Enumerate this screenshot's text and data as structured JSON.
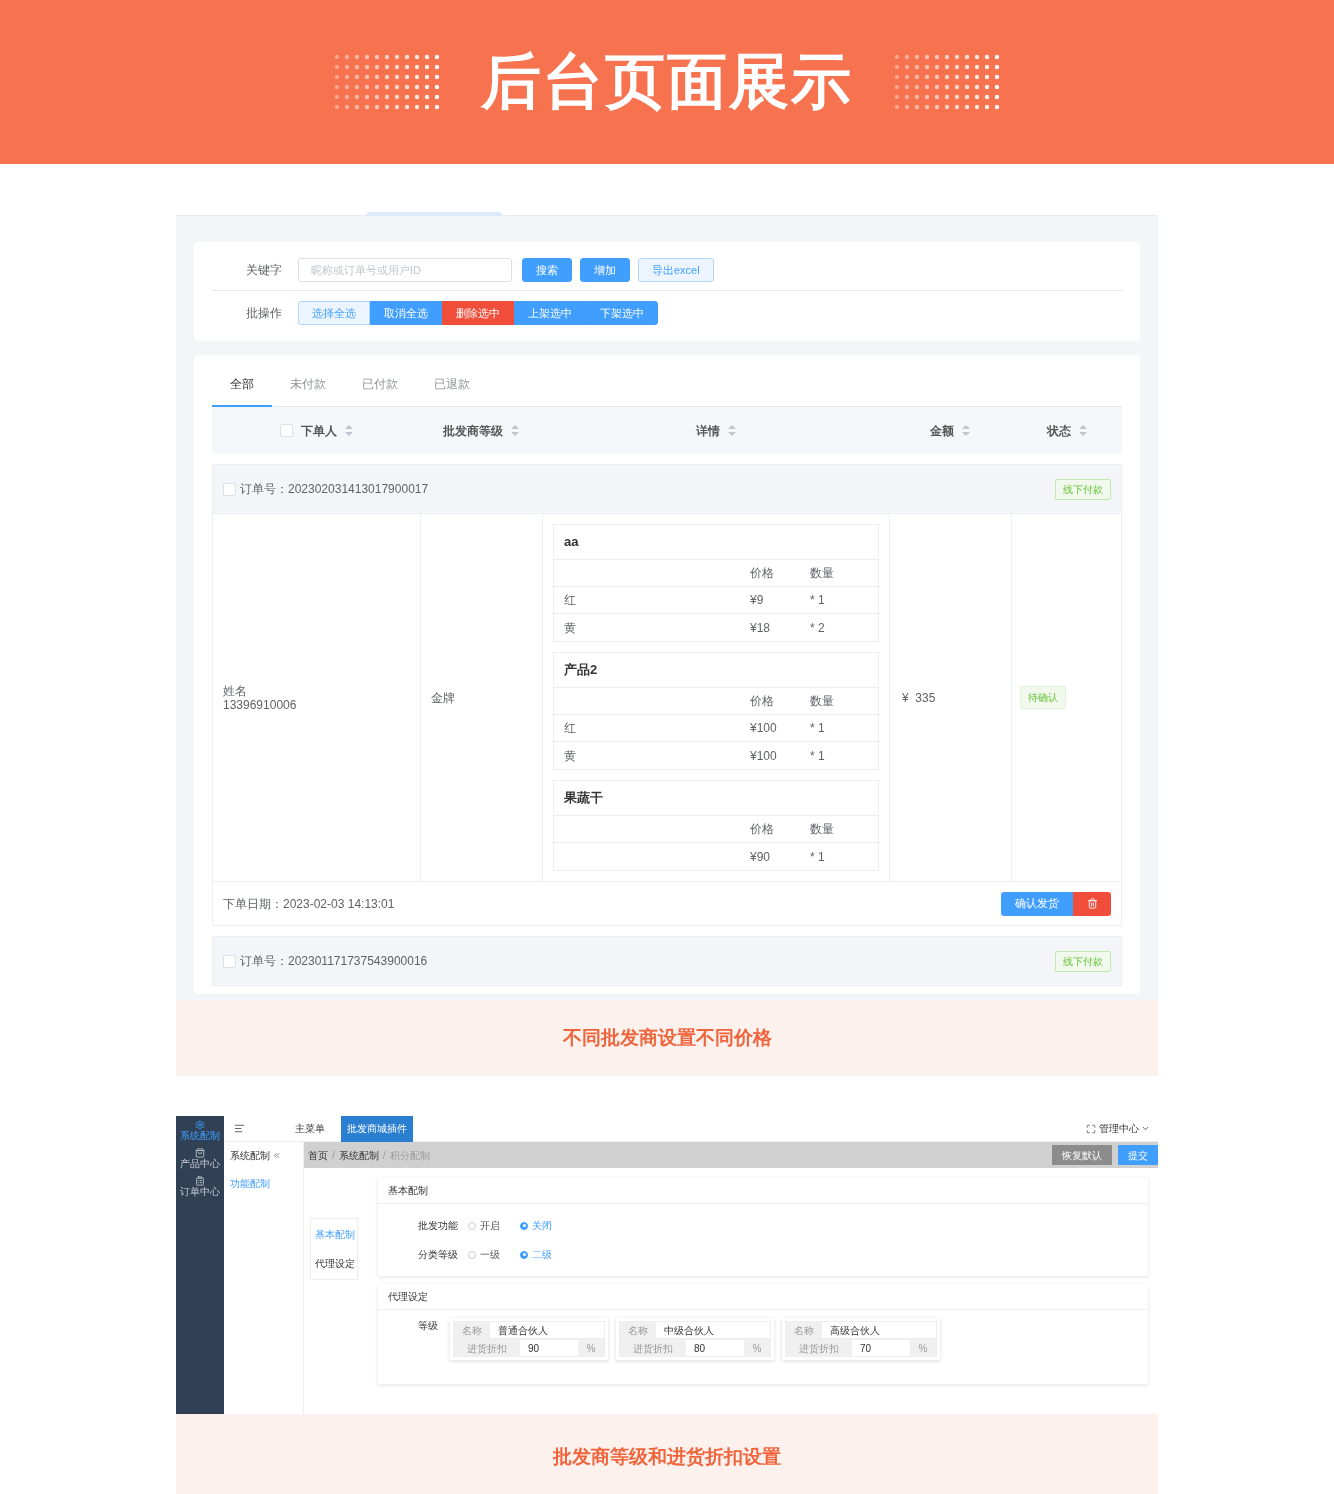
{
  "banner": {
    "title": "后台页面展示"
  },
  "order_admin": {
    "search": {
      "label": "关键字",
      "placeholder": "昵称或订单号或用户ID",
      "buttons": [
        {
          "label": "搜索",
          "kind": "primary"
        },
        {
          "label": "增加",
          "kind": "primary"
        },
        {
          "label": "导出excel",
          "kind": "plain"
        }
      ]
    },
    "batch": {
      "label": "批操作",
      "buttons": [
        {
          "label": "选择全选",
          "kind": "plain"
        },
        {
          "label": "取消全选",
          "kind": "primary"
        },
        {
          "label": "删除选中",
          "kind": "danger"
        },
        {
          "label": "上架选中",
          "kind": "primary"
        },
        {
          "label": "下架选中",
          "kind": "primary"
        }
      ]
    },
    "tabs": [
      {
        "label": "全部",
        "selected": true
      },
      {
        "label": "未付款",
        "selected": false
      },
      {
        "label": "已付款",
        "selected": false
      },
      {
        "label": "已退款",
        "selected": false
      }
    ],
    "table": {
      "select_all_checked": false,
      "columns": [
        "下单人",
        "批发商等级",
        "详情",
        "金额",
        "状态"
      ],
      "orders": [
        {
          "checked": false,
          "order_no": "订单号：202302031413017900017",
          "payment_tag": "线下付款",
          "buyer": [
            "姓名",
            "13396910006"
          ],
          "level": "金牌",
          "products": [
            {
              "name": "aa",
              "headers": [
                "价格",
                "数量"
              ],
              "rows": [
                {
                  "variant": "红",
                  "price": "¥9",
                  "qty": "* 1"
                },
                {
                  "variant": "黄",
                  "price": "¥18",
                  "qty": "* 2"
                }
              ]
            },
            {
              "name": "产品2",
              "headers": [
                "价格",
                "数量"
              ],
              "rows": [
                {
                  "variant": "红",
                  "price": "¥100",
                  "qty": "* 1"
                },
                {
                  "variant": "黄",
                  "price": "¥100",
                  "qty": "* 1"
                }
              ]
            },
            {
              "name": "果蔬干",
              "headers": [
                "价格",
                "数量"
              ],
              "rows": [
                {
                  "price": "¥90",
                  "qty": "* 1"
                }
              ]
            }
          ],
          "amount": "¥  335",
          "status": "待确认",
          "date": "下单日期：2023-02-03 14:13:01",
          "actions": [
            {
              "kind": "primary",
              "label": "确认发货"
            },
            {
              "kind": "delete"
            }
          ]
        },
        {
          "checked": false,
          "order_no": "订单号：202301171737543900016",
          "payment_tag": "线下付款"
        }
      ]
    },
    "caption": "不同批发商设置不同价格"
  },
  "wholesale_settings": {
    "sidebar": [
      {
        "label": "系统配制",
        "selected": true,
        "kind": "gear"
      },
      {
        "label": "产品中心",
        "selected": false,
        "kind": "bag"
      },
      {
        "label": "订单中心",
        "selected": false,
        "kind": "clipboard"
      }
    ],
    "top_tabs": [
      {
        "label": "主菜单",
        "selected": false
      },
      {
        "label": "批发商城插件",
        "selected": true
      }
    ],
    "user_menu": "管理中心",
    "subnav": {
      "title": "系统配制",
      "items": [
        {
          "label": "功能配制",
          "selected": true
        }
      ]
    },
    "breadcrumb_separator": "/",
    "breadcrumb": [
      {
        "label": "首页",
        "selected": false
      },
      {
        "label": "系统配制",
        "selected": false
      },
      {
        "label": "积分配制",
        "selected": true
      }
    ],
    "actions": [
      {
        "label": "恢复默认",
        "kind": "secondary"
      },
      {
        "label": "提交",
        "kind": "primary"
      }
    ],
    "section_nav": [
      {
        "label": "基本配制",
        "selected": true
      },
      {
        "label": "代理设定",
        "selected": false
      }
    ],
    "basic": {
      "title": "基本配制",
      "fields": [
        {
          "label": "批发功能",
          "options": [
            {
              "label": "开启",
              "selected": false
            },
            {
              "label": "关闭",
              "selected": true
            }
          ]
        },
        {
          "label": "分类等级",
          "options": [
            {
              "label": "一级",
              "selected": false
            },
            {
              "label": "二级",
              "selected": true
            }
          ]
        }
      ]
    },
    "agents": {
      "title": "代理设定",
      "label": "等级",
      "levels": [
        {
          "name_label": "名称",
          "name": "普通合伙人",
          "discount_label": "进货折扣",
          "discount": "90",
          "unit": "%"
        },
        {
          "name_label": "名称",
          "name": "中级合伙人",
          "discount_label": "进货折扣",
          "discount": "80",
          "unit": "%"
        },
        {
          "name_label": "名称",
          "name": "高级合伙人",
          "discount_label": "进货折扣",
          "discount": "70",
          "unit": "%"
        }
      ]
    },
    "caption": "批发商等级和进货折扣设置"
  }
}
